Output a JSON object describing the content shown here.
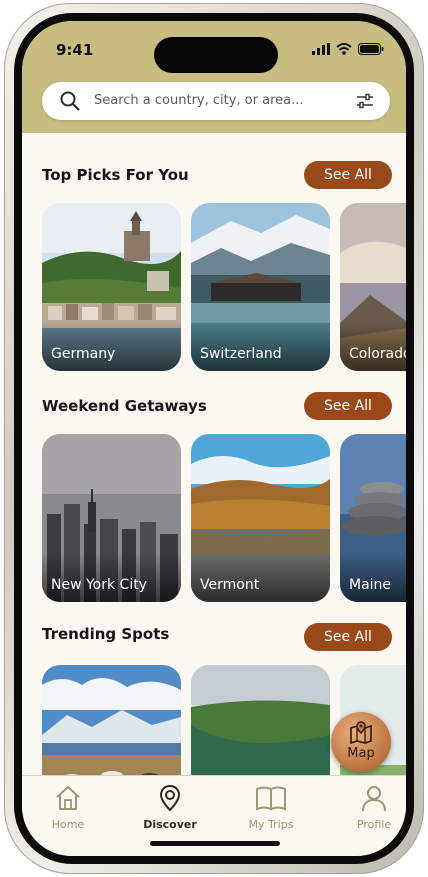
{
  "status_bar": {
    "time": "9:41"
  },
  "search": {
    "placeholder": "Search a country, city, or area..."
  },
  "sections": [
    {
      "title": "Top Picks For You",
      "action": "See All",
      "cards": [
        "Germany",
        "Switzerland",
        "Colorado"
      ]
    },
    {
      "title": "Weekend Getaways",
      "action": "See All",
      "cards": [
        "New York City",
        "Vermont",
        "Maine"
      ]
    },
    {
      "title": "Trending Spots",
      "action": "See All",
      "cards": [
        "",
        "",
        ""
      ]
    }
  ],
  "map_button": {
    "label": "Map"
  },
  "tabs": [
    {
      "label": "Home",
      "icon": "home-icon",
      "active": false
    },
    {
      "label": "Discover",
      "icon": "discover-pin-icon",
      "active": true
    },
    {
      "label": "My Trips",
      "icon": "book-icon",
      "active": false
    },
    {
      "label": "Profile",
      "icon": "person-icon",
      "active": false
    }
  ],
  "colors": {
    "header": "#c7bd80",
    "accent": "#9a4a1a",
    "background": "#fbf8f2",
    "tab_inactive": "#9c9775"
  }
}
